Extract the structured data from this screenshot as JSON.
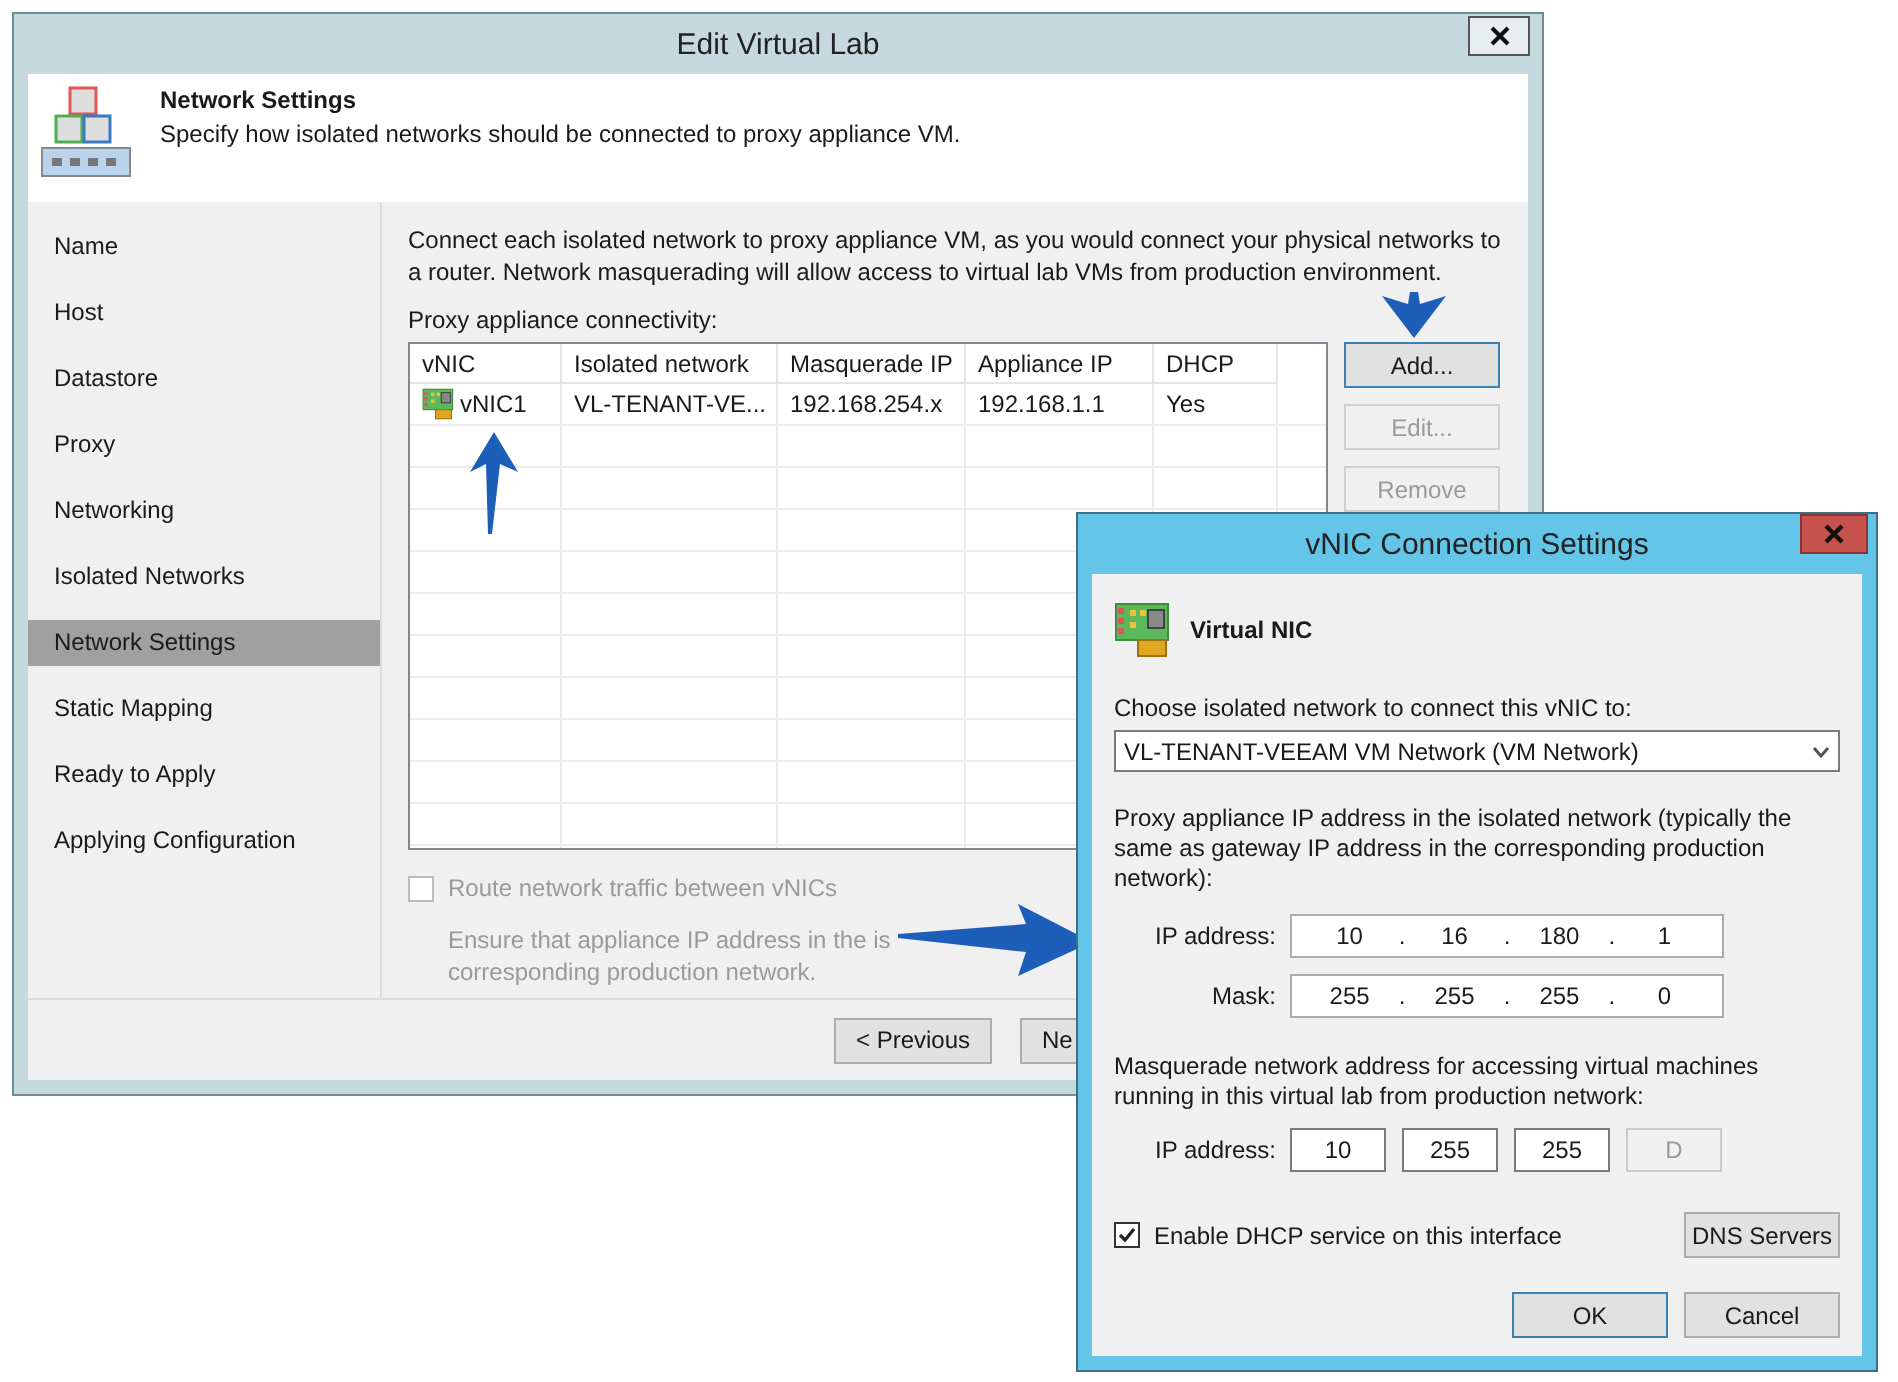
{
  "main_window": {
    "title": "Edit Virtual Lab",
    "header": {
      "title": "Network Settings",
      "subtitle": "Specify how isolated networks should be connected to proxy appliance VM."
    },
    "steps": [
      {
        "label": "Name",
        "selected": false
      },
      {
        "label": "Host",
        "selected": false
      },
      {
        "label": "Datastore",
        "selected": false
      },
      {
        "label": "Proxy",
        "selected": false
      },
      {
        "label": "Networking",
        "selected": false
      },
      {
        "label": "Isolated Networks",
        "selected": false
      },
      {
        "label": "Network Settings",
        "selected": true
      },
      {
        "label": "Static Mapping",
        "selected": false
      },
      {
        "label": "Ready to Apply",
        "selected": false
      },
      {
        "label": "Applying Configuration",
        "selected": false
      }
    ],
    "description": "Connect each isolated network to proxy appliance VM, as you would connect your physical networks to a router. Network masquerading will allow access to virtual lab VMs from production environment.",
    "table": {
      "label": "Proxy appliance connectivity:",
      "columns": [
        "vNIC",
        "Isolated network",
        "Masquerade IP",
        "Appliance IP",
        "DHCP"
      ],
      "rows": [
        {
          "cells": [
            "vNIC1",
            "VL-TENANT-VE...",
            "192.168.254.x",
            "192.168.1.1",
            "Yes"
          ]
        }
      ]
    },
    "buttons": [
      {
        "label": "Add...",
        "disabled": false,
        "default": true
      },
      {
        "label": "Edit...",
        "disabled": true,
        "default": false
      },
      {
        "label": "Remove",
        "disabled": true,
        "default": false
      }
    ],
    "route_option": {
      "label": "Route network traffic between vNICs",
      "checked": false,
      "disabled": true
    },
    "route_note": [
      "Ensure that appliance IP address in the is",
      "corresponding production network."
    ],
    "footer_buttons": [
      "< Previous",
      "Ne"
    ]
  },
  "dialog": {
    "title": "vNIC Connection Settings",
    "heading": "Virtual NIC",
    "network_label": "Choose isolated network to connect this vNIC to:",
    "network_value": "VL-TENANT-VEEAM VM Network (VM Network)",
    "appliance_text": "Proxy appliance IP address in the isolated network (typically the same as gateway IP address in the corresponding production network):",
    "appliance_fields": [
      {
        "label": "IP address:",
        "octets": [
          "10",
          "16",
          "180",
          "1"
        ],
        "separators": [
          ".",
          ".",
          "."
        ]
      },
      {
        "label": "Mask:",
        "octets": [
          "255",
          "255",
          "255",
          "0"
        ],
        "separators": [
          ".",
          ".",
          "."
        ]
      }
    ],
    "masquerade_text": "Masquerade network address for accessing virtual machines running in this virtual lab from production network:",
    "masquerade_field": {
      "label": "IP address:",
      "octets": [
        {
          "value": "10",
          "disabled": false
        },
        {
          "value": "255",
          "disabled": false
        },
        {
          "value": "255",
          "disabled": false
        },
        {
          "value": "D",
          "disabled": true
        }
      ]
    },
    "dhcp_option": {
      "label": "Enable DHCP service on this interface",
      "checked": true
    },
    "dns_button": "DNS Servers",
    "buttons": [
      {
        "label": "OK",
        "default": true
      },
      {
        "label": "Cancel",
        "default": false
      }
    ]
  }
}
